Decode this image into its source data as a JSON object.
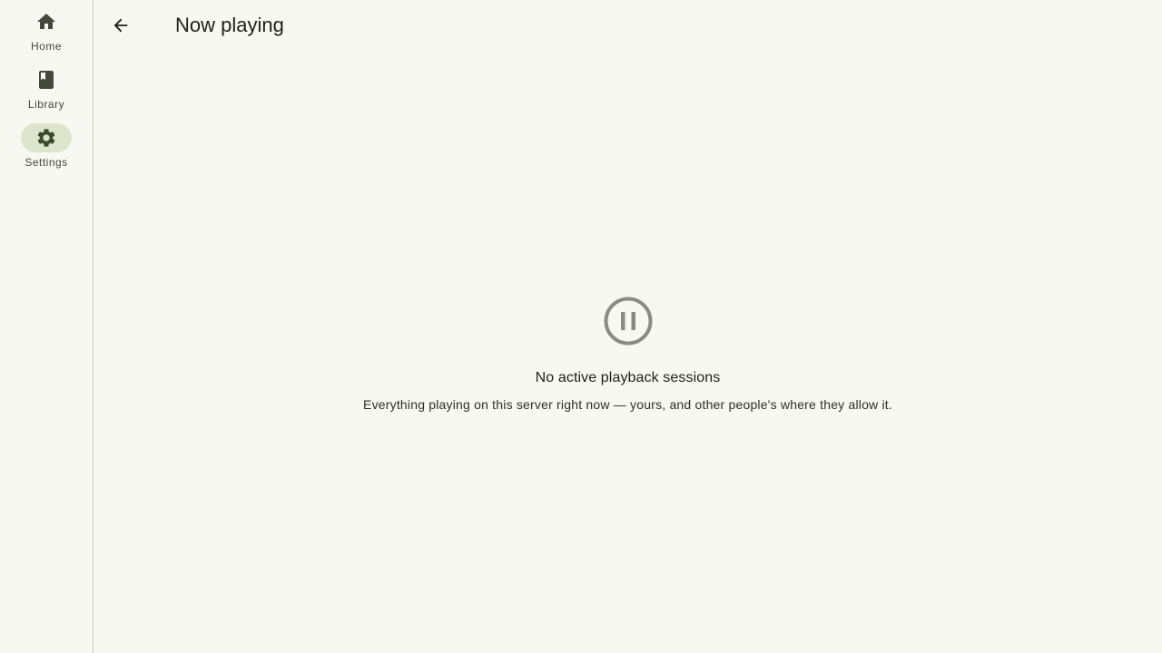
{
  "nav": {
    "items": [
      {
        "label": "Home",
        "icon": "home-icon",
        "active": false
      },
      {
        "label": "Library",
        "icon": "book-icon",
        "active": false
      },
      {
        "label": "Settings",
        "icon": "gear-icon",
        "active": true
      }
    ]
  },
  "header": {
    "back_icon": "arrow-back-icon",
    "title": "Now playing"
  },
  "empty_state": {
    "icon": "pause-circle-icon",
    "title": "No active playback sessions",
    "description": "Everything playing on this server right now — yours, and other people's where they allow it."
  },
  "colors": {
    "background": "#f8f8f2",
    "active_indicator": "#dde6cd",
    "icon_muted": "#8a8c84",
    "divider": "#c6c8be"
  }
}
